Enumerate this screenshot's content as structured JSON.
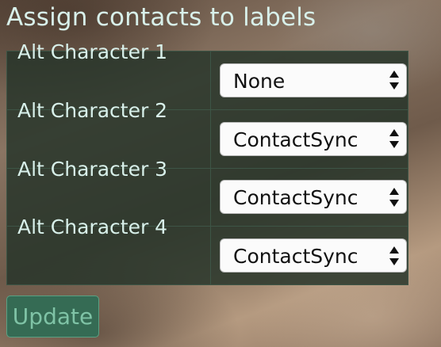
{
  "page": {
    "title": "Assign contacts to labels"
  },
  "rows": [
    {
      "label": "Alt Character 1",
      "selected": "None"
    },
    {
      "label": "Alt Character 2",
      "selected": "ContactSync"
    },
    {
      "label": "Alt Character 3",
      "selected": "ContactSync"
    },
    {
      "label": "Alt Character 4",
      "selected": "ContactSync"
    }
  ],
  "actions": {
    "update_label": "Update"
  },
  "colors": {
    "title_text": "#d8f0ea",
    "table_background": "#26342a",
    "button_background": "#356b54",
    "button_text": "#7fc3a6"
  },
  "icons": {
    "select_indicator": "up-down-chevron-icon"
  }
}
